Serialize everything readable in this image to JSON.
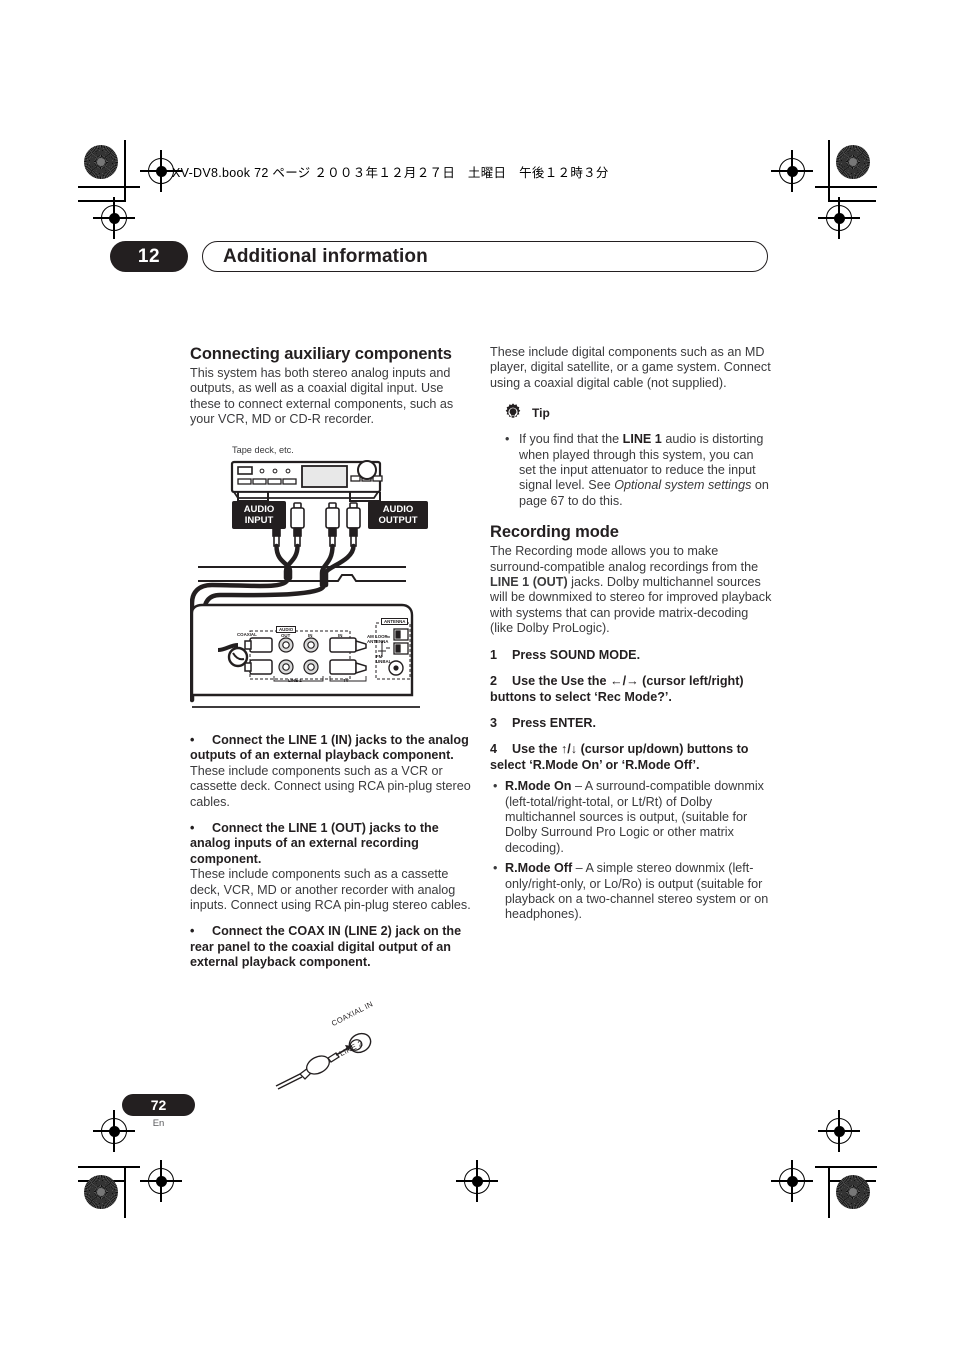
{
  "print_header": {
    "filename_line": "XV-DV8.book  72 ページ  ２００３年１２月２７日　土曜日　午後１２時３分"
  },
  "chapter": {
    "number": "12",
    "title": "Additional information"
  },
  "left_column": {
    "heading": "Connecting auxiliary components",
    "intro": "This system has both stereo analog inputs and outputs, as well as a coaxial digital input. Use these to connect external components, such as your VCR, MD or CD-R recorder.",
    "bullets": [
      {
        "head": "Connect the LINE 1 (IN) jacks to the analog outputs of an external playback component.",
        "body": "These include components such as a VCR or cassette deck. Connect using RCA pin-plug stereo cables."
      },
      {
        "head": "Connect the LINE 1 (OUT) jacks to the analog inputs of an external recording component.",
        "body": "These include components such as a cassette deck, VCR, MD or another recorder with analog inputs. Connect using RCA pin-plug stereo cables."
      },
      {
        "head": "Connect the COAX IN (LINE 2) jack on the rear panel to the coaxial digital output of an external playback component.",
        "body": ""
      }
    ]
  },
  "diagram": {
    "caption": "Tape deck, etc.",
    "audio_input_label_line1": "AUDIO",
    "audio_input_label_line2": "INPUT",
    "audio_output_label_line1": "AUDIO",
    "audio_output_label_line2": "OUTPUT",
    "rear_panel_labels": {
      "audio": "AUDIO",
      "coaxial": "COAXIAL",
      "out": "OUT",
      "in1": "IN",
      "in2": "IN",
      "line1": "LINE 1",
      "tv": "TV",
      "antenna": "ANTENNA",
      "am_loop_antenna": "AM LOOP\nANTENNA",
      "fm_unbal": "FM\nUNBAL"
    }
  },
  "coax_illustration": {
    "label_top": "COAXIAL IN",
    "label_bottom": "LINE 2"
  },
  "right_column": {
    "intro": "These include digital components such as an MD player, digital satellite, or a game system. Connect using a coaxial digital cable (not supplied).",
    "tip": {
      "label": "Tip",
      "bullet_parts": {
        "p1": "If you find that the ",
        "bold1": "LINE 1",
        "p2": " audio is distorting when played through this system, you can set the input attenuator to reduce the input signal level. See ",
        "italic1": "Optional system settings",
        "p3": " on page 67 to do this."
      }
    },
    "recording_mode": {
      "heading": "Recording mode",
      "intro_parts": {
        "p1": "The Recording mode allows you to make surround-compatible analog recordings from the ",
        "bold1": "LINE 1 (OUT)",
        "p2": " jacks. Dolby multichannel sources will be downmixed to stereo for improved playback with systems that can provide matrix-decoding (like Dolby ProLogic)."
      },
      "steps": [
        {
          "num": "1",
          "text": "Press SOUND MODE."
        },
        {
          "num": "2",
          "text": "Use the Use the ←/→ (cursor left/right) buttons to select ‘Rec Mode?’."
        },
        {
          "num": "3",
          "text": "Press ENTER."
        },
        {
          "num": "4",
          "text": "Use the ↑/↓ (cursor up/down) buttons to select ‘R.Mode On’ or ‘R.Mode Off’."
        }
      ],
      "mode_bullets": [
        {
          "bold": "R.Mode On",
          "text": " – A surround-compatible downmix (left-total/right-total, or Lt/Rt) of Dolby multichannel sources is output, (suitable for Dolby Surround Pro Logic or other matrix decoding)."
        },
        {
          "bold": "R.Mode Off",
          "text": " – A simple stereo downmix (left-only/right-only, or Lo/Ro) is output (suitable for playback on a two-channel stereo system or on headphones)."
        }
      ]
    }
  },
  "footer": {
    "page_number": "72",
    "language": "En"
  },
  "colors": {
    "ink": "#231f20",
    "body_text": "#3a3a3c",
    "paper": "#ffffff"
  }
}
